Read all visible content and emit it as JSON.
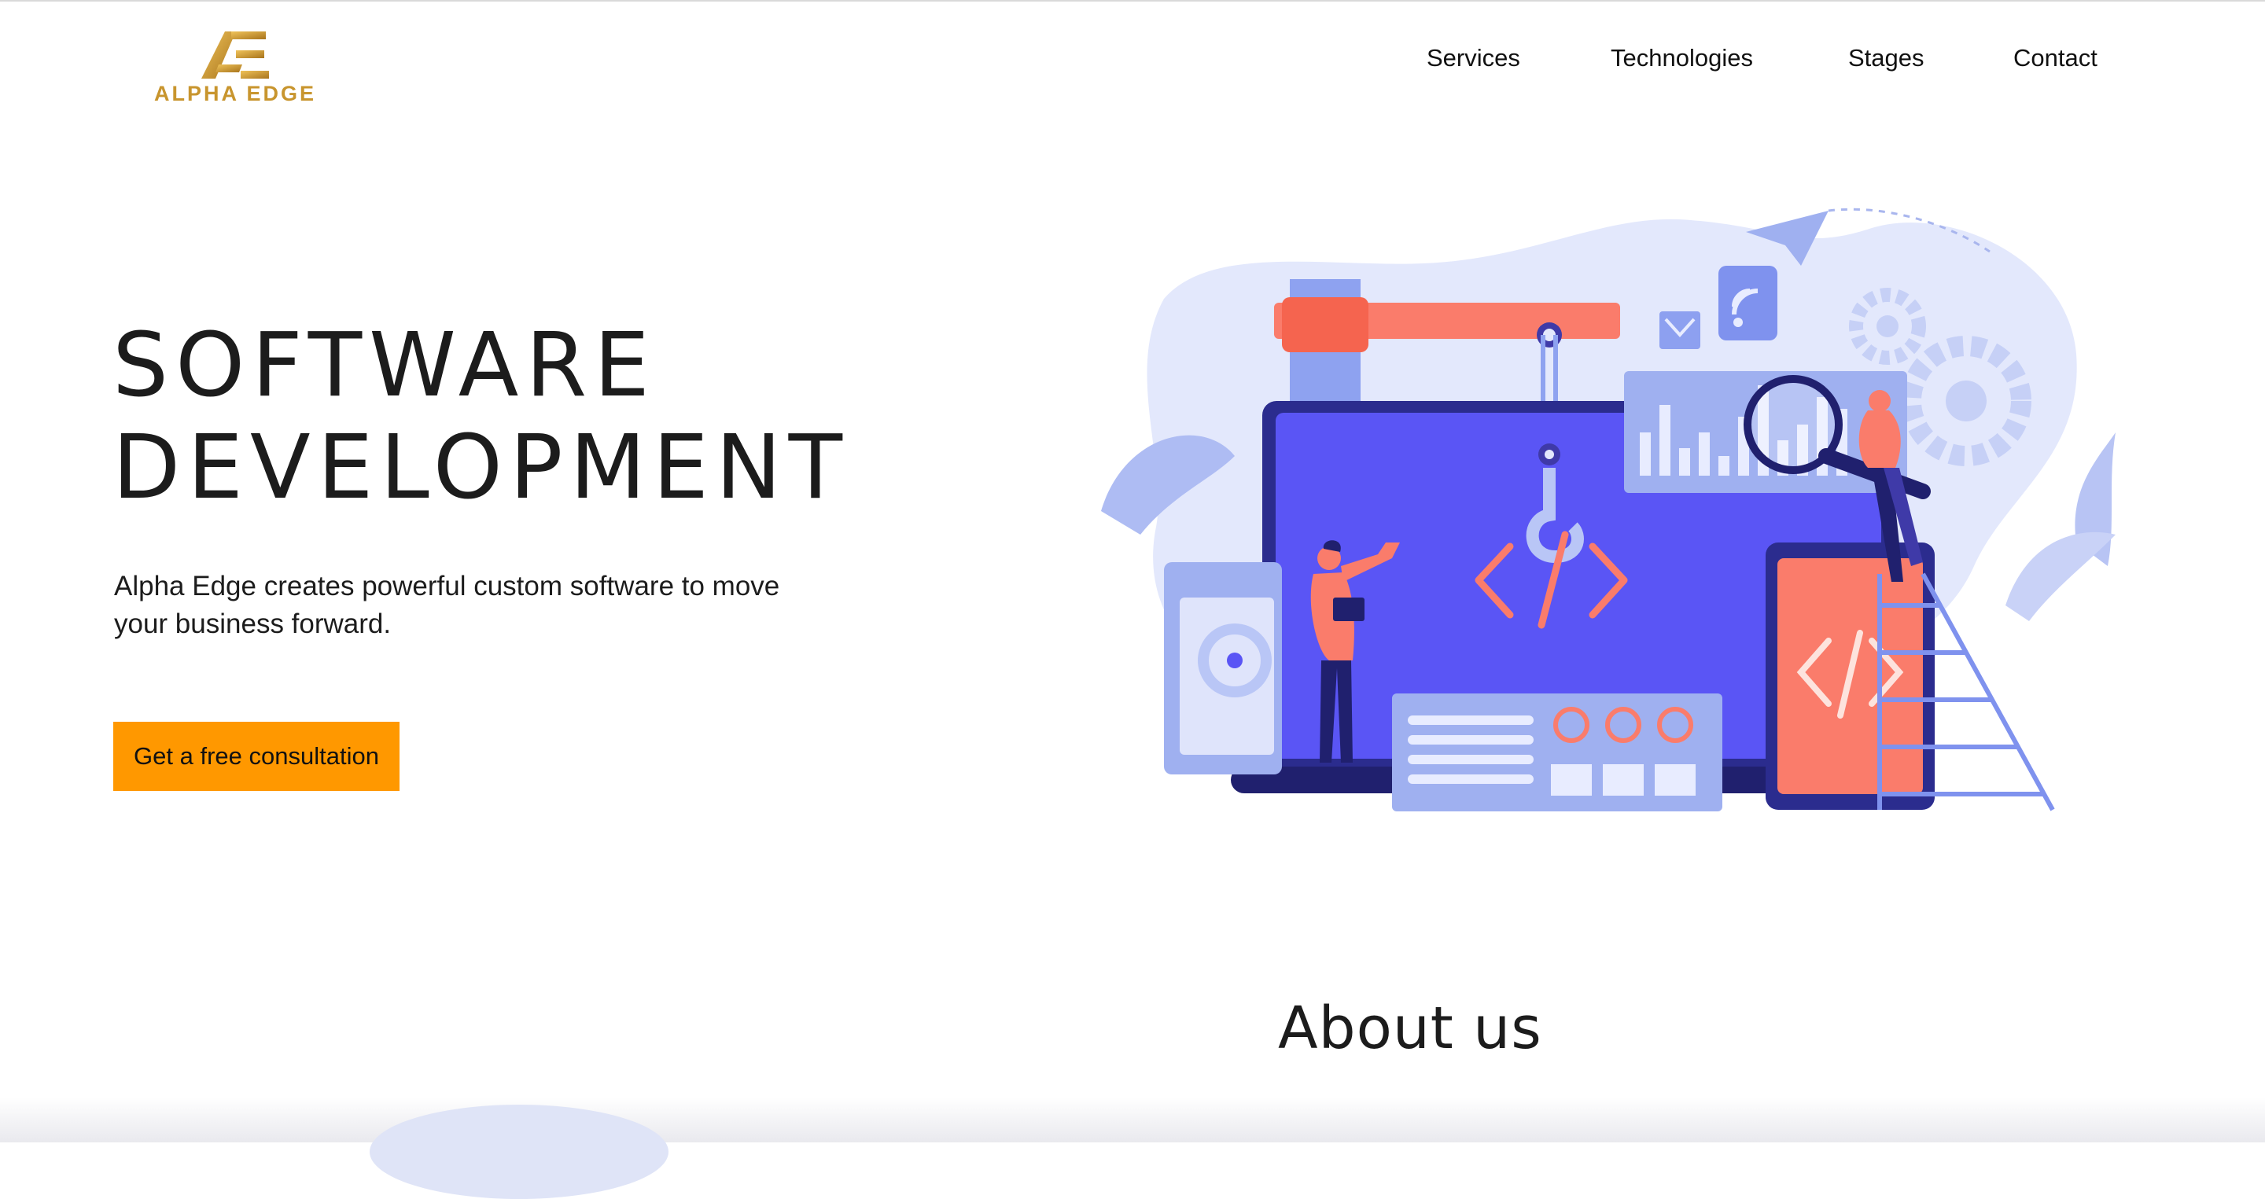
{
  "brand": {
    "name": "ALPHA EDGE",
    "logo_icon": "alpha-edge-monogram",
    "gold": "#c8952e"
  },
  "nav": {
    "items": [
      {
        "label": "Services"
      },
      {
        "label": "Technologies"
      },
      {
        "label": "Stages"
      },
      {
        "label": "Contact"
      }
    ]
  },
  "hero": {
    "title_line1": "SOFTWARE",
    "title_line2": "DEVELOPMENT",
    "subtitle": "Alpha Edge creates powerful custom software to move your business forward.",
    "cta_label": "Get a free consultation",
    "cta_color": "#ff9800",
    "illustration": "software-development-illustration"
  },
  "about": {
    "title": "About us"
  },
  "colors": {
    "illustration_blue": "#5a55f5",
    "illustration_coral": "#fa7c6b",
    "illustration_light": "#dfe4fb"
  }
}
